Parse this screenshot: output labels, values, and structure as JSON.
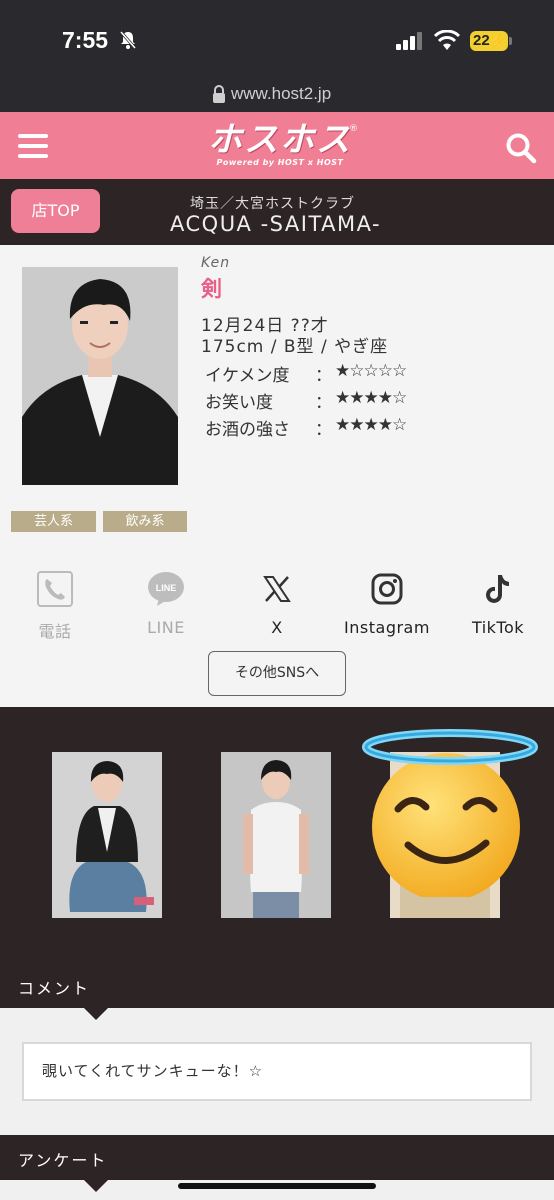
{
  "status_bar": {
    "time": "7:55",
    "battery": "22"
  },
  "browser": {
    "url": "www.host2.jp"
  },
  "header": {
    "logo_main": "ホスホス",
    "logo_sub": "Powered by HOST x HOST",
    "logo_reg": "®",
    "brand_color": "#f07f96"
  },
  "shop": {
    "top_button": "店TOP",
    "area": "埼玉／大宮ホストクラブ",
    "name": "ACQUA -SAITAMA-"
  },
  "profile": {
    "romaji": "Ken",
    "name": "剣",
    "birthday_age": "12月24日 ??才",
    "physical": "175cm / B型 / やぎ座",
    "ratings": [
      {
        "label": "イケメン度",
        "colon": "：",
        "stars": "★☆☆☆☆",
        "value": 1
      },
      {
        "label": "お笑い度",
        "colon": "：",
        "stars": "★★★★☆",
        "value": 4
      },
      {
        "label": "お酒の強さ",
        "colon": "：",
        "stars": "★★★★☆",
        "value": 4
      }
    ],
    "tags": [
      "芸人系",
      "飲み系"
    ]
  },
  "sns": [
    {
      "label": "電話",
      "icon": "phone-icon",
      "enabled": false
    },
    {
      "label": "LINE",
      "icon": "line-icon",
      "enabled": false
    },
    {
      "label": "X",
      "icon": "x-icon",
      "enabled": true
    },
    {
      "label": "Instagram",
      "icon": "instagram-icon",
      "enabled": true
    },
    {
      "label": "TikTok",
      "icon": "tiktok-icon",
      "enabled": true
    }
  ],
  "line_icon_text": "LINE",
  "other_sns_button": "その他SNSへ",
  "sections": {
    "comment_heading": "コメント",
    "comment_text": "覗いてくれてサンキューな！☆",
    "survey_heading": "アンケート"
  }
}
